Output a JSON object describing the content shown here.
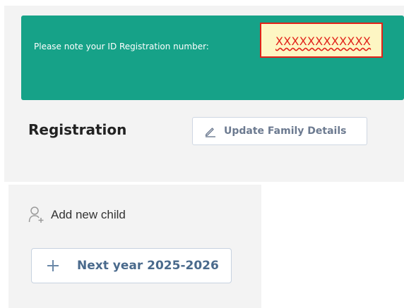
{
  "notice": {
    "message": "Please note your ID Registration number:",
    "id_value": "XXXXXXXXXXXX"
  },
  "registration": {
    "title": "Registration",
    "update_button_label": "Update Family Details",
    "update_icon": "pencil-icon"
  },
  "children": {
    "add_child_label": "Add new child",
    "add_child_icon": "add-user-icon",
    "next_year_button_label": "Next year 2025-2026",
    "next_year_icon": "plus-icon"
  },
  "colors": {
    "banner": "#16a288",
    "id_box_border": "#e2231a",
    "id_box_background": "#fdf6c3",
    "panel_background": "#f3f3f3",
    "button_text": "#6c7a90",
    "next_year_text": "#4a6a8c"
  }
}
